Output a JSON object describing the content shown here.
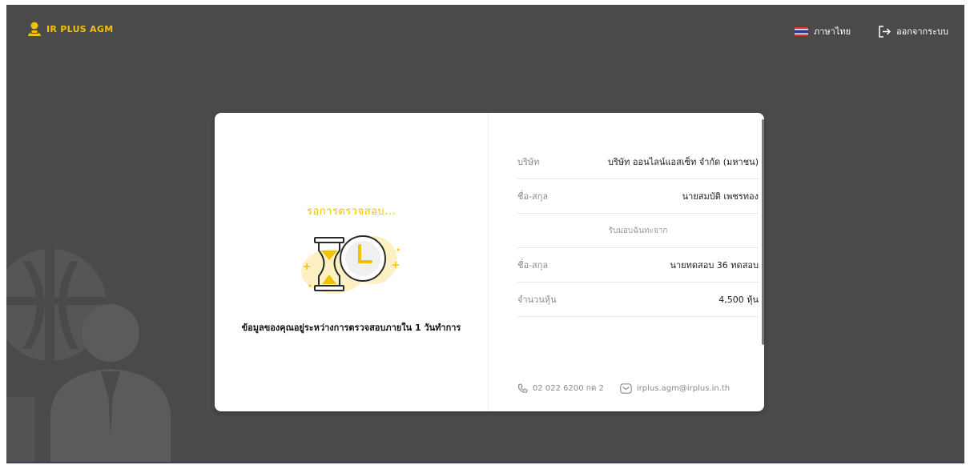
{
  "header": {
    "logo_text": "IR PLUS AGM",
    "language_label": "ภาษาไทย",
    "logout_label": "ออกจากระบบ"
  },
  "status": {
    "title": "รอการตรวจสอบ...",
    "message": "ข้อมูลของคุณอยู่ระหว่างการตรวจสอบภายใน 1 วันทำการ"
  },
  "info": {
    "company_label": "บริษัท",
    "company_value": "บริษัท ออนไลน์แอสเซ็ท จำกัด (มหาชน)",
    "name_label": "ชื่อ-สกุล",
    "name_value": "นายสมบัติ เพชรทอง",
    "proxy_heading": "รับมอบฉันทะจาก",
    "proxy_name_label": "ชื่อ-สกุล",
    "proxy_name_value": "นายทดสอบ 36 ทดสอบ",
    "shares_label": "จำนวนหุ้น",
    "shares_value": "4,500 หุ้น"
  },
  "contact": {
    "phone": "02 022 6200 กด 2",
    "email": "irplus.agm@irplus.in.th"
  },
  "colors": {
    "background": "#4a4a4a",
    "accent": "#f2c200",
    "card": "#ffffff"
  },
  "icons": [
    "agm-logo-icon",
    "thai-flag-icon",
    "logout-icon",
    "hourglass-clock-icon",
    "phone-icon",
    "email-icon"
  ]
}
